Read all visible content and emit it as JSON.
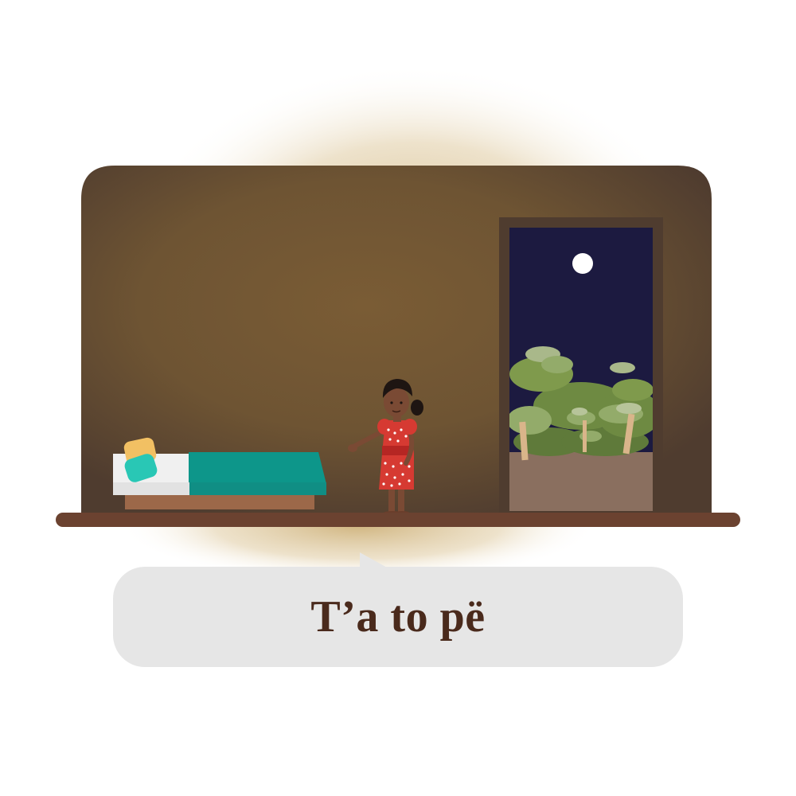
{
  "caption": {
    "text": "T’a to pë"
  },
  "scene": {
    "description_icons": [
      "room-illustration",
      "bed-icon",
      "girl-figure",
      "open-doorway",
      "moon-icon",
      "trees-icon"
    ]
  },
  "colors": {
    "wall": "#6e5433",
    "wall_edge": "#4f3c2f",
    "floor": "#6b4230",
    "night_sky": "#1c1a40",
    "bed_blanket": "#0d968a",
    "caption_bg": "#e6e6e6",
    "caption_text": "#4a2a1c"
  }
}
